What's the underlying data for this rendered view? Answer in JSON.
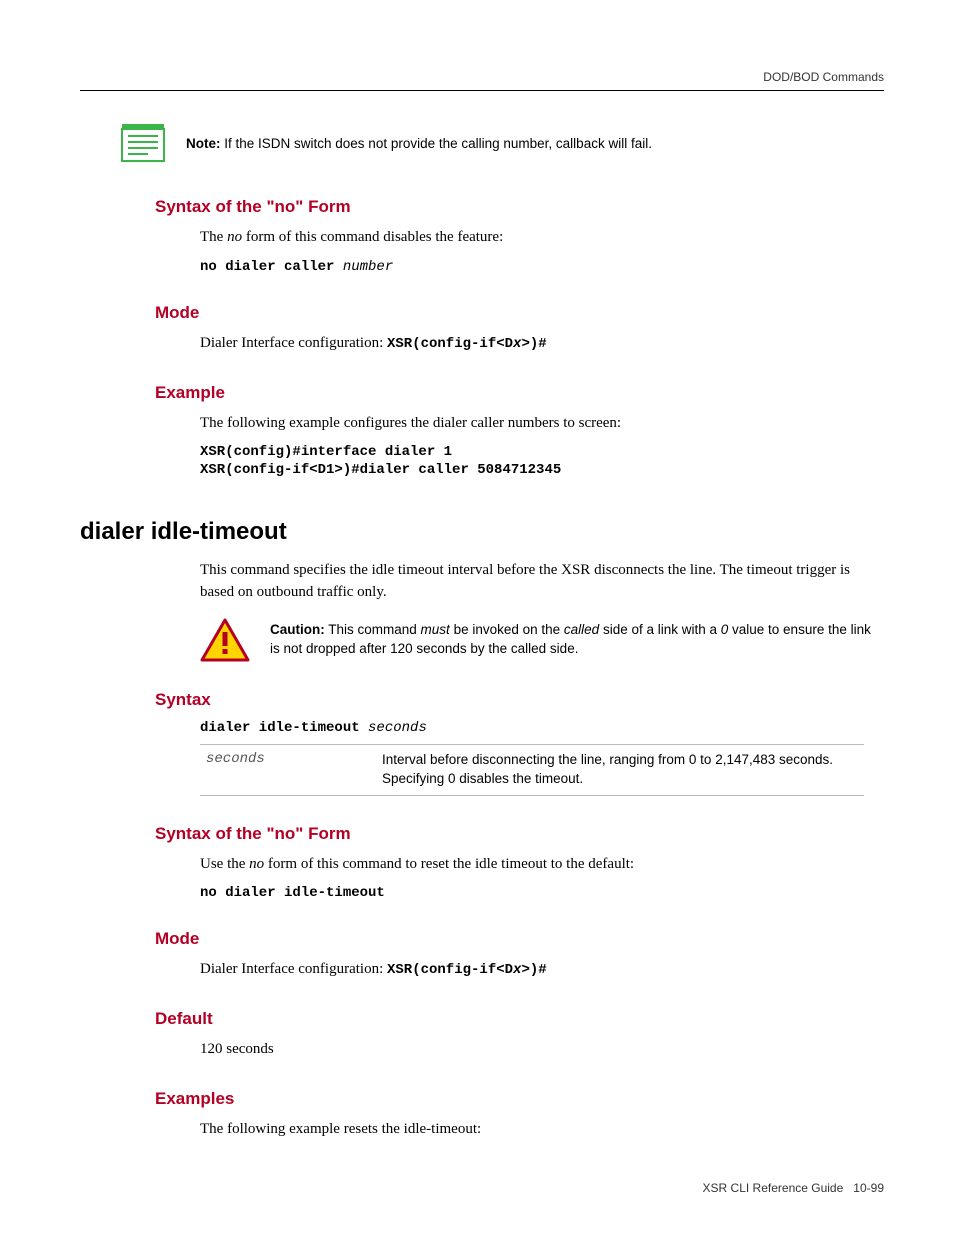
{
  "header": {
    "breadcrumb": "DOD/BOD Commands"
  },
  "note1": {
    "label": "Note:",
    "text": " If the ISDN switch does not provide the calling number, callback will fail."
  },
  "section1": {
    "no_form": {
      "heading": "Syntax of the \"no\" Form",
      "intro_pre": "The ",
      "intro_em": "no",
      "intro_post": " form of this command disables the feature:",
      "code": "no dialer caller ",
      "code_param": "number"
    },
    "mode": {
      "heading": "Mode",
      "intro": "Dialer Interface configuration: ",
      "prompt_pre": "XSR(config-if<D",
      "prompt_em": "x",
      "prompt_post": ">)#"
    },
    "example": {
      "heading": "Example",
      "intro": "The following example configures the dialer caller numbers to screen:",
      "code_lines": [
        "XSR(config)#interface dialer 1",
        "XSR(config-if<D1>)#dialer caller 5084712345"
      ]
    }
  },
  "section2": {
    "title": "dialer idle-timeout",
    "intro": "This command specifies the idle timeout interval before the XSR disconnects the line. The timeout trigger is based on outbound traffic only.",
    "caution": {
      "label": "Caution:",
      "p1": " This command ",
      "em1": "must",
      "p2": " be invoked on the ",
      "em2": "called",
      "p3": " side of a link with a ",
      "em3": "0",
      "p4": " value to ensure the link is not dropped after 120 seconds by the called side."
    },
    "syntax": {
      "heading": "Syntax",
      "code": "dialer idle-timeout ",
      "code_param": "seconds",
      "param_name": "seconds",
      "param_desc": "Interval before disconnecting the line, ranging from 0 to 2,147,483 seconds. Specifying 0 disables the timeout."
    },
    "no_form": {
      "heading": "Syntax of the \"no\" Form",
      "intro_pre": "Use the ",
      "intro_em": "no",
      "intro_post": " form of this command to reset the idle timeout to the default:",
      "code": "no dialer idle-timeout"
    },
    "mode": {
      "heading": "Mode",
      "intro": "Dialer Interface configuration: ",
      "prompt_pre": "XSR(config-if<D",
      "prompt_em": "x",
      "prompt_post": ">)#"
    },
    "default": {
      "heading": "Default",
      "value": "120 seconds"
    },
    "examples": {
      "heading": "Examples",
      "intro": "The following example resets the idle-timeout:"
    }
  },
  "footer": {
    "doc_title": "XSR CLI Reference Guide",
    "page_no": "10-99"
  }
}
